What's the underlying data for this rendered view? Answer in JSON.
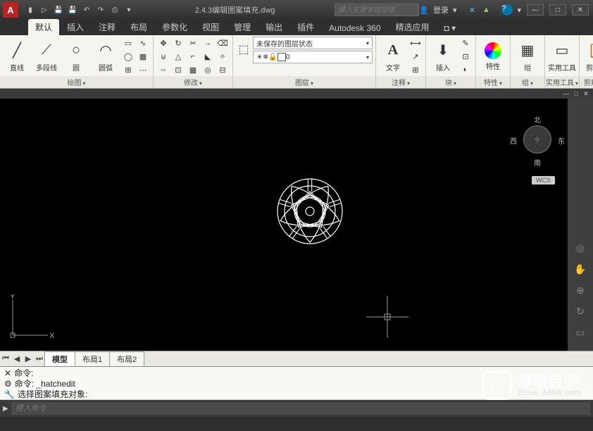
{
  "title": "2.4.3编辑图案填充.dwg",
  "app_letter": "A",
  "search_placeholder": "键入关键字或短语",
  "login_label": "登录",
  "qat": [
    "新",
    "开",
    "保",
    "另",
    "↶",
    "↷",
    "打"
  ],
  "title_icons": [
    "X",
    "✕",
    "▲"
  ],
  "help_icon": "?",
  "winbtns": [
    "—",
    "□",
    "✕"
  ],
  "tabs": [
    "默认",
    "插入",
    "注释",
    "布局",
    "参数化",
    "视图",
    "管理",
    "输出",
    "插件",
    "Autodesk 360",
    "精选应用"
  ],
  "active_tab": 0,
  "groups": {
    "draw": {
      "title": "绘图",
      "btns": [
        {
          "ico": "╱",
          "label": "直线"
        },
        {
          "ico": "⟋",
          "label": "多段线"
        },
        {
          "ico": "○",
          "label": "圆"
        },
        {
          "ico": "◠",
          "label": "圆弧"
        }
      ],
      "small": [
        "▭",
        "⬡",
        "◔",
        "◐",
        "⊞",
        "⋯"
      ]
    },
    "modify": {
      "title": "修改",
      "small": [
        "✧",
        "◐",
        "✂",
        "⇔",
        "△",
        "□",
        "▥",
        "⊡",
        "⊟",
        "↻",
        "⌐",
        "⊞",
        "◫",
        "▦",
        "⊕"
      ]
    },
    "layer": {
      "title": "图层",
      "unsaved": "未保存的图层状态",
      "current": "0",
      "icons": [
        "☀",
        "❄",
        "🔓",
        "▭"
      ]
    },
    "annot": {
      "title": "注释",
      "text_label": "文字",
      "btns": [
        "A",
        "▭",
        "⊞",
        "田"
      ]
    },
    "block": {
      "title": "块",
      "label": "插入",
      "icons": [
        "⊞",
        "✎",
        "⊡",
        "◐"
      ]
    },
    "props": {
      "title": "特性",
      "ico": "◉"
    },
    "group": {
      "title": "组",
      "ico": "▦"
    },
    "util": {
      "title": "实用工具",
      "ico": "▭"
    },
    "clip": {
      "title": "剪贴板",
      "ico": "📋"
    }
  },
  "doc_winbtns": [
    "—",
    "□",
    "✕"
  ],
  "nav": {
    "n": "北",
    "s": "南",
    "e": "东",
    "w": "西"
  },
  "wcs": "WCS",
  "ucs": {
    "x": "X",
    "y": "Y"
  },
  "model_tabs": {
    "nav": [
      "⏮",
      "◀",
      "▶",
      "⏭"
    ],
    "tabs": [
      "模型",
      "布局1",
      "布局2"
    ],
    "active": 0
  },
  "cmd": {
    "hist": [
      "命令:",
      "命令: _hatchedit",
      "选择图案填充对象:"
    ],
    "icons": [
      "⚙",
      "⚙",
      "🔧"
    ],
    "prompt_icon": "▶",
    "placeholder": "键入命令"
  },
  "right_tools": [
    "◎",
    "✋",
    "⊕",
    "↻",
    "▭"
  ],
  "watermark": {
    "cn": "溜溜自学",
    "url": "zixue.3d66.com"
  }
}
